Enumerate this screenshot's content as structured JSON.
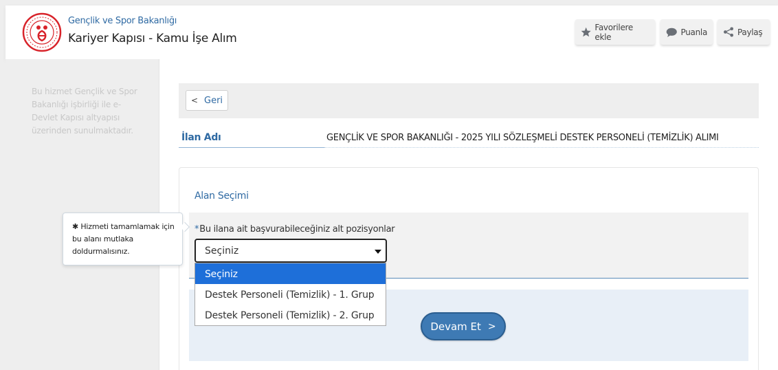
{
  "header": {
    "org_name": "Gençlik ve Spor Bakanlığı",
    "service_title": "Kariyer Kapısı - Kamu İşe Alım",
    "buttons": {
      "favorite": "Favorilere ekle",
      "rate": "Puanla",
      "share": "Paylaş"
    },
    "accent_color": "#2f6aa3",
    "logo_color": "#d8232a"
  },
  "sidebar": {
    "note": "Bu hizmet Gençlik ve Spor Bakanlığı işbirliği ile e-Devlet Kapısı altyapısı üzerinden sunulmaktadır."
  },
  "main": {
    "back_label": "Geri",
    "ad_label": "İlan Adı",
    "ad_value": "GENÇLİK VE SPOR BAKANLIĞI - 2025 YILI SÖZLEŞMELİ DESTEK PERSONELİ (TEMİZLİK) ALIMI",
    "section_title": "Alan Seçimi",
    "field": {
      "required_mark": "*",
      "label": "Bu ilana ait başvurabileceğiniz alt pozisyonlar",
      "selected_value": "Seçiniz",
      "options": [
        "Seçiniz",
        "Destek Personeli (Temizlik) - 1. Grup",
        "Destek Personeli (Temizlik) - 2. Grup"
      ]
    },
    "continue_label": "Devam Et",
    "tooltip": {
      "icon": "✱",
      "text": "Hizmeti tamamlamak için bu alanı mutlaka doldurmalısınız."
    }
  }
}
